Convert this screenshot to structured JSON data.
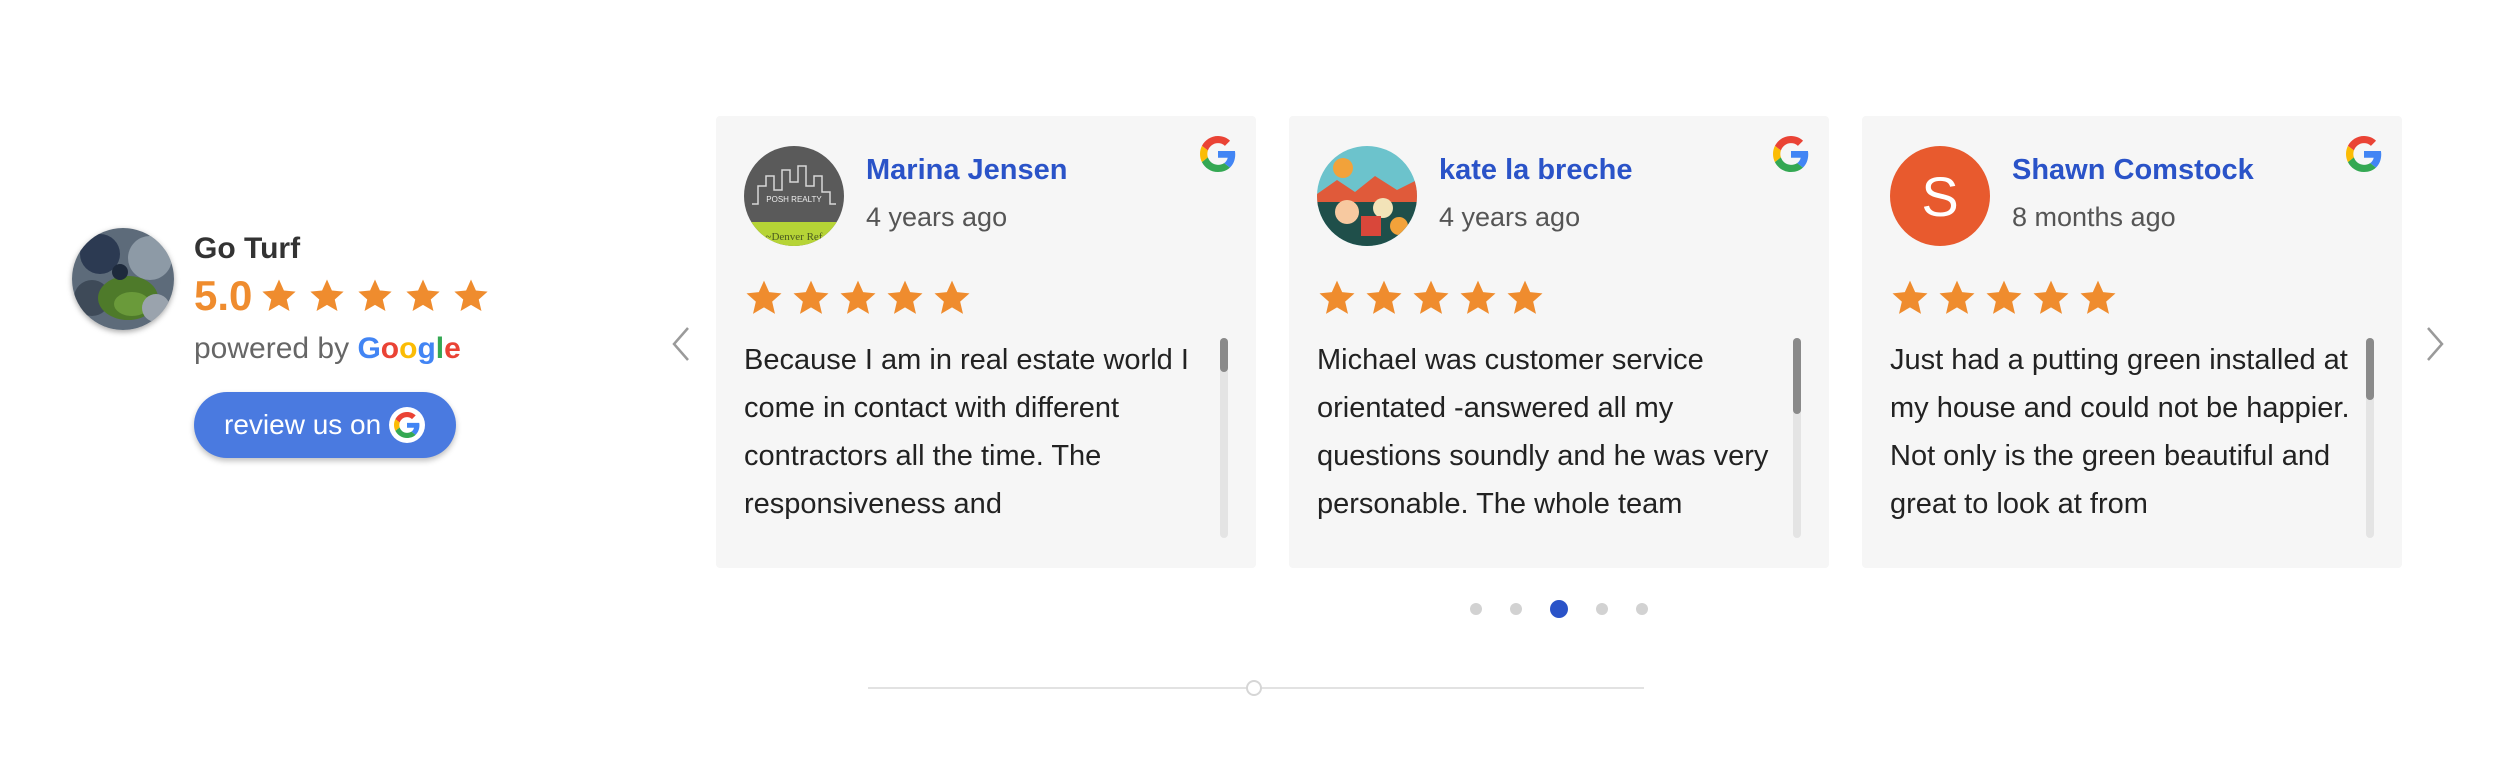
{
  "business": {
    "name": "Go Turf",
    "rating": "5.0",
    "stars": 5,
    "powered_prefix": "powered by",
    "google_letters": [
      "G",
      "o",
      "o",
      "g",
      "l",
      "e"
    ],
    "review_button_label": "review us on"
  },
  "colors": {
    "star": "#ef8c2e",
    "reviewer_name": "#2a53c8",
    "button": "#4a7ae0",
    "active_dot": "#2a53c8",
    "google_letters": [
      "#4285F4",
      "#EA4335",
      "#FBBC05",
      "#4285F4",
      "#34A853",
      "#EA4335"
    ]
  },
  "reviews": [
    {
      "name": "Marina Jensen",
      "age": "4 years ago",
      "stars": 5,
      "avatar_logo_text": "POSH REALTY",
      "avatar_sub_text": "~Denver Ref",
      "text": "Because I am in real estate world I come in contact with different contractors all the time. The responsiveness and"
    },
    {
      "name": "kate la breche",
      "age": "4 years ago",
      "stars": 5,
      "avatar_icon": "illustration-avatar",
      "text": "Michael was customer service orientated -answered all my questions soundly  and  he was very personable. The whole team"
    },
    {
      "name": "Shawn Comstock",
      "age": "8 months ago",
      "stars": 5,
      "avatar_letter": "S",
      "text": "Just had a putting green installed at my house and could not be happier.  Not only is the green beautiful and great to look at from"
    }
  ],
  "carousel": {
    "page_count": 5,
    "active_page_index": 2
  },
  "icons": {
    "prev": "chevron-left-icon",
    "next": "chevron-right-icon",
    "google": "google-g-icon",
    "star": "star-icon"
  }
}
